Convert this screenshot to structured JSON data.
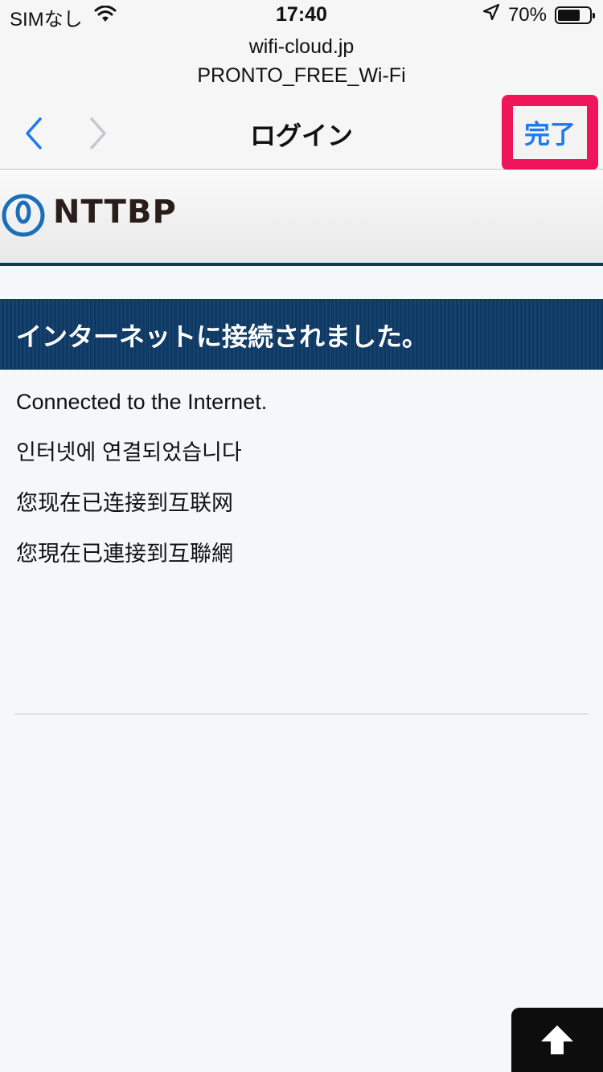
{
  "status_bar": {
    "carrier": "SIMなし",
    "time": "17:40",
    "battery_percent": "70%",
    "battery_level": 0.7
  },
  "browser": {
    "url": "wifi-cloud.jp",
    "ssid": "PRONTO_FREE_Wi-Fi",
    "title": "ログイン",
    "done_label": "完了"
  },
  "site": {
    "logo_text": "NTTBP",
    "banner": "インターネットに接続されました。",
    "messages": [
      "Connected to the Internet.",
      "인터넷에 연결되었습니다",
      "您现在已连接到互联网",
      "您現在已連接到互聯網"
    ]
  },
  "icons": {
    "wifi": "wifi-icon",
    "location": "location-arrow-icon",
    "battery": "battery-icon",
    "back": "chevron-left-icon",
    "forward": "chevron-right-icon",
    "logo": "nttbp-logo-icon",
    "scroll_top": "arrow-up-icon"
  },
  "colors": {
    "accent_blue": "#1a7af0",
    "highlight": "#f0145a",
    "banner_bg": "#0d3964"
  }
}
